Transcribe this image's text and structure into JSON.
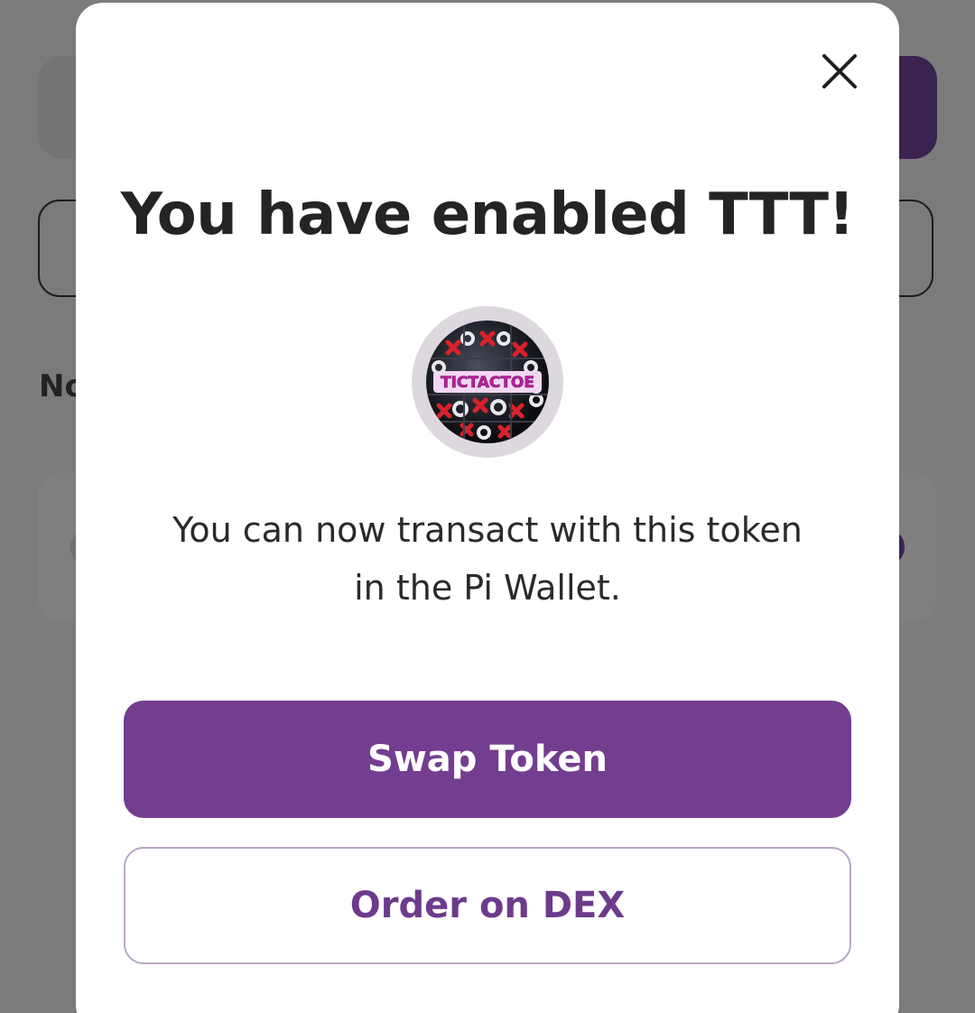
{
  "background": {
    "partial_label": "No"
  },
  "modal": {
    "title": "You have enabled TTT!",
    "token_logo_text": "TICTACTOE",
    "message": "You can now transact with this token in the Pi Wallet.",
    "primary_button_label": "Swap Token",
    "secondary_button_label": "Order on DEX",
    "close_icon": "close-icon"
  },
  "colors": {
    "accent": "#733d90",
    "accent_text": "#6c3b8c",
    "overlay": "#7b7b7b"
  }
}
